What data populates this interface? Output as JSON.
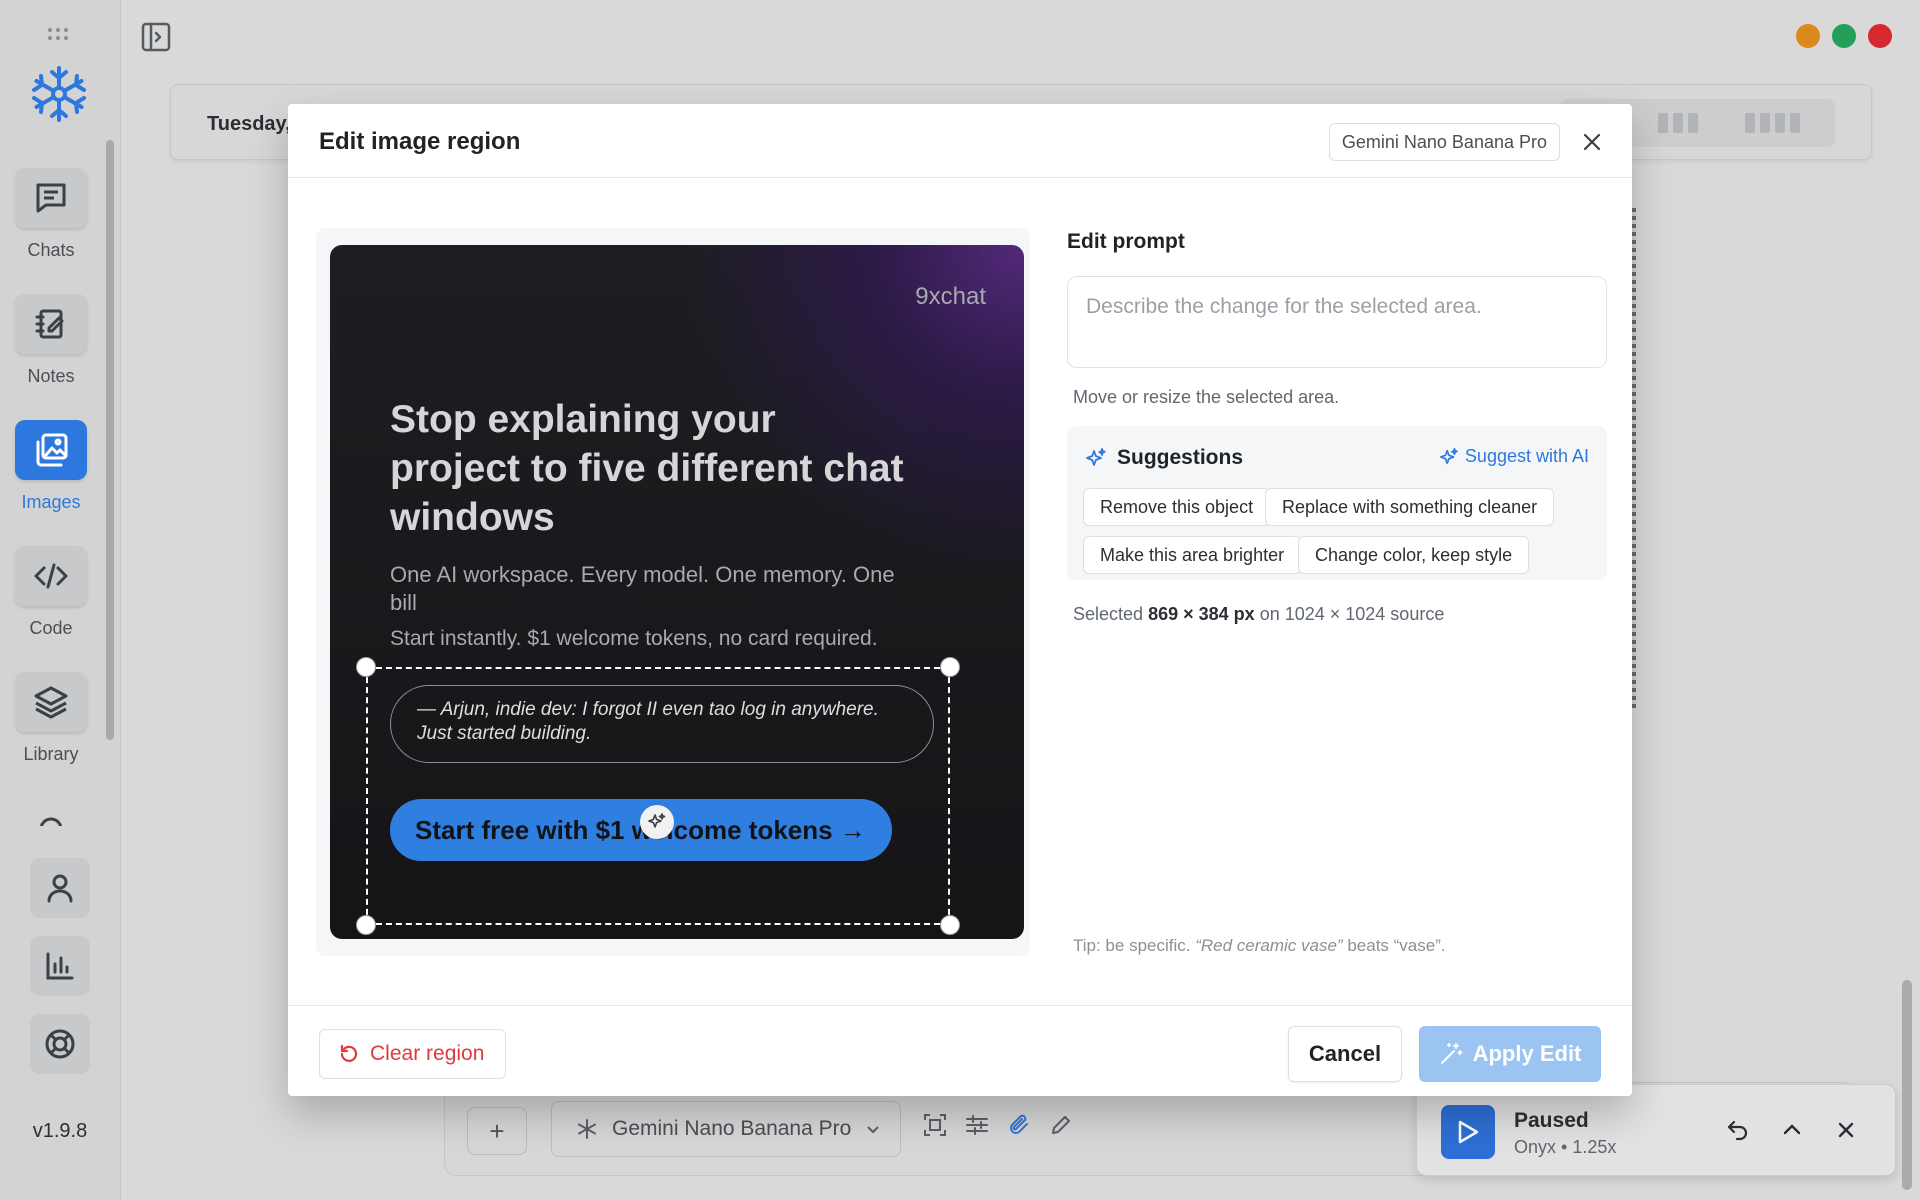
{
  "sidebar": {
    "items": [
      {
        "label": "Chats",
        "icon": "chat-icon"
      },
      {
        "label": "Notes",
        "icon": "notebook-icon"
      },
      {
        "label": "Images",
        "icon": "images-icon",
        "active": true
      },
      {
        "label": "Code",
        "icon": "code-icon"
      },
      {
        "label": "Library",
        "icon": "layers-icon"
      }
    ],
    "bottom_icons": [
      "user-icon",
      "bar-chart-icon",
      "lifebuoy-icon"
    ],
    "version": "v1.9.8"
  },
  "background": {
    "date_text": "Tuesday,",
    "composer": {
      "model": "Gemini Nano Banana Pro",
      "tools": [
        "scan-icon",
        "sliders-icon",
        "paperclip-icon",
        "pencil-icon"
      ]
    },
    "player": {
      "status": "Paused",
      "voice": "Onyx • 1.25x"
    },
    "window_dots": [
      "#d98a1a",
      "#22a058",
      "#d8282f"
    ]
  },
  "modal": {
    "title": "Edit image region",
    "model_badge": "Gemini Nano Banana Pro",
    "artwork": {
      "brand": "9xchat",
      "headline": "Stop explaining your project to five different chat windows",
      "subline": "One AI workspace. Every model. One memory. One bill",
      "note": "Start instantly. $1 welcome tokens, no card required.",
      "quote": "— Arjun, indie dev: I forgot II even tao log in anywhere. Just started building.",
      "cta": "Start free with $1 welcome tokens →"
    },
    "edit_prompt": {
      "label": "Edit prompt",
      "placeholder": "Describe the change for the selected area.",
      "value": "",
      "hint": "Move or resize the selected area."
    },
    "suggestions": {
      "title": "Suggestions",
      "ai_button": "Suggest with AI",
      "chips": [
        "Remove this object",
        "Replace with something cleaner",
        "Make this area brighter",
        "Change color, keep style"
      ]
    },
    "selection": {
      "prefix": "Selected",
      "size": "869 × 384 px",
      "suffix": "on 1024 × 1024 source"
    },
    "tip": {
      "lead": "Tip: be specific.",
      "example": "“Red ceramic vase”",
      "trail": "beats “vase”."
    },
    "footer": {
      "clear": "Clear region",
      "cancel": "Cancel",
      "apply": "Apply Edit"
    }
  },
  "colors": {
    "accent": "#2d78de",
    "danger": "#e03a3e",
    "apply_disabled": "#9cc4f2"
  }
}
